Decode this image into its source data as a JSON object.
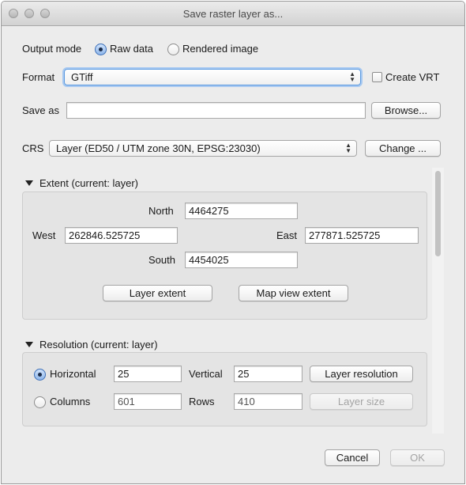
{
  "window": {
    "title": "Save raster layer as..."
  },
  "output_mode": {
    "label": "Output mode",
    "options": [
      {
        "label": "Raw data",
        "selected": true
      },
      {
        "label": "Rendered image",
        "selected": false
      }
    ]
  },
  "format": {
    "label": "Format",
    "value": "GTiff",
    "create_vrt_label": "Create VRT",
    "create_vrt_checked": false
  },
  "save_as": {
    "label": "Save as",
    "value": "",
    "browse_label": "Browse..."
  },
  "crs": {
    "label": "CRS",
    "value": "Layer (ED50 / UTM zone 30N, EPSG:23030)",
    "change_label": "Change ..."
  },
  "extent": {
    "title": "Extent (current: layer)",
    "north_label": "North",
    "north_value": "4464275",
    "west_label": "West",
    "west_value": "262846.525725",
    "east_label": "East",
    "east_value": "277871.525725",
    "south_label": "South",
    "south_value": "4454025",
    "layer_extent_label": "Layer extent",
    "map_view_extent_label": "Map view extent"
  },
  "resolution": {
    "title": "Resolution (current: layer)",
    "horizontal_label": "Horizontal",
    "horizontal_value": "25",
    "horizontal_selected": true,
    "vertical_label": "Vertical",
    "vertical_value": "25",
    "layer_resolution_label": "Layer resolution",
    "columns_label": "Columns",
    "columns_value": "601",
    "columns_selected": false,
    "rows_label": "Rows",
    "rows_value": "410",
    "layer_size_label": "Layer size"
  },
  "footer": {
    "cancel_label": "Cancel",
    "ok_label": "OK"
  },
  "colors": {
    "accent": "#3c6fb8",
    "focus_ring": "#a8c9f1",
    "window_bg": "#ececec",
    "group_bg": "#e4e4e4"
  }
}
